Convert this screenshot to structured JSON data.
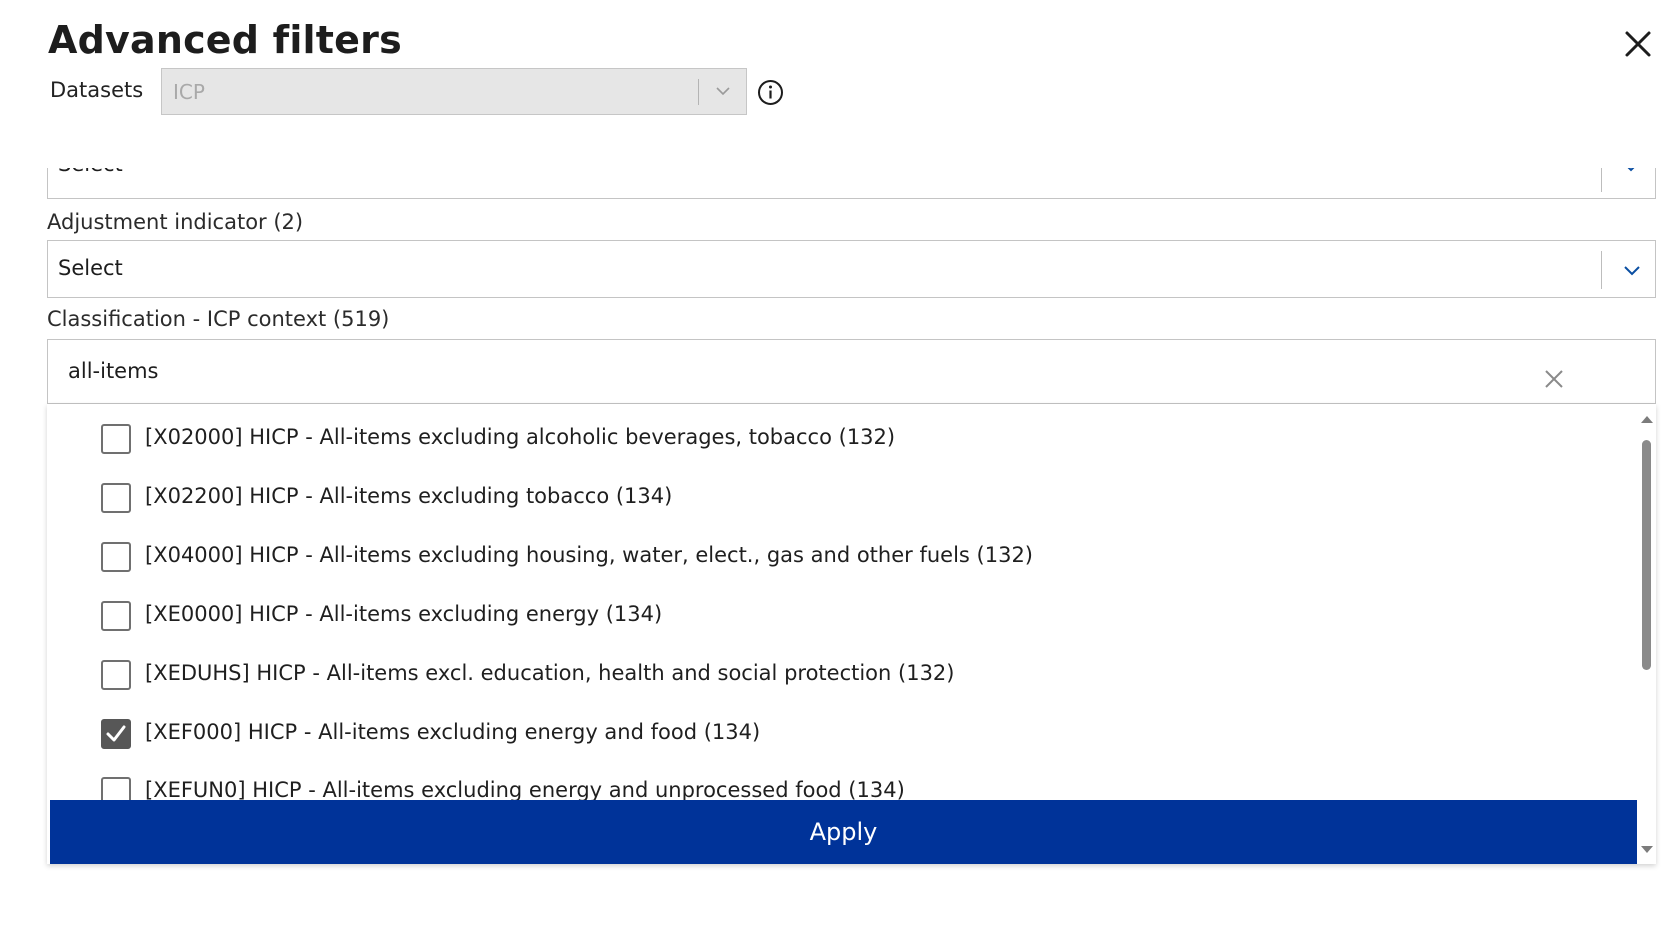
{
  "dialog": {
    "title": "Advanced filters"
  },
  "datasets": {
    "label": "Datasets",
    "value": "ICP"
  },
  "partial_select": {
    "value": "Select"
  },
  "adjustment": {
    "label": "Adjustment indicator (2)",
    "value": "Select"
  },
  "classification": {
    "label": "Classification - ICP context (519)",
    "search_value": "all-items",
    "options": [
      {
        "label": "[X02000] HICP - All-items excluding alcoholic beverages, tobacco (132)",
        "checked": false
      },
      {
        "label": "[X02200] HICP - All-items excluding tobacco (134)",
        "checked": false
      },
      {
        "label": "[X04000] HICP - All-items excluding housing, water, elect., gas and other fuels (132)",
        "checked": false
      },
      {
        "label": "[XE0000] HICP - All-items excluding energy (134)",
        "checked": false
      },
      {
        "label": "[XEDUHS] HICP - All-items excl. education, health and social protection (132)",
        "checked": false
      },
      {
        "label": "[XEF000] HICP - All-items excluding energy and food (134)",
        "checked": true
      },
      {
        "label": "[XEFUN0] HICP - All-items excluding energy and unprocessed food (134)",
        "checked": false
      }
    ]
  },
  "apply": {
    "label": "Apply"
  },
  "colors": {
    "apply_bg": "#003399",
    "chevron_accent": "#0a4ea2",
    "checkbox_checked": "#575757"
  }
}
